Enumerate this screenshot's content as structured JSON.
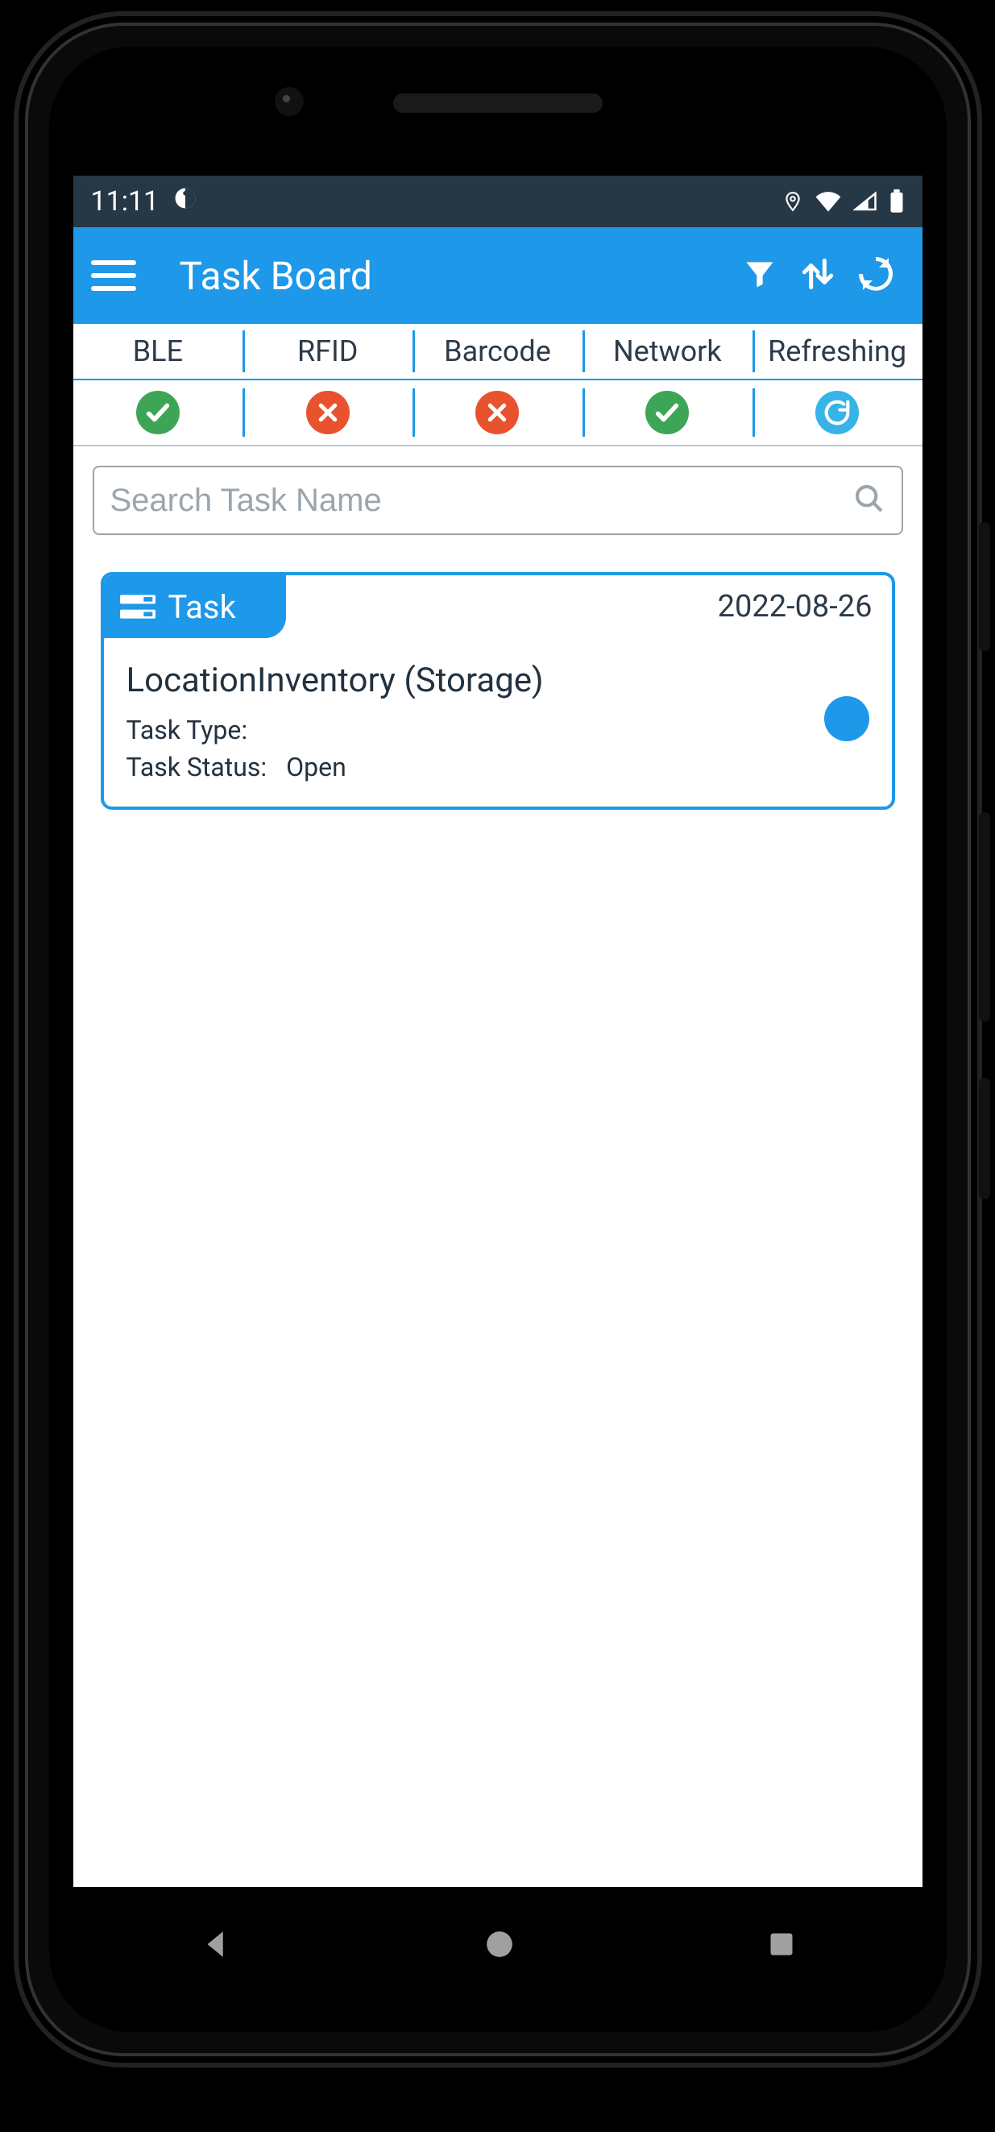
{
  "status_bar": {
    "time": "11:11",
    "icons": {
      "app_indicator": "app-indicator-icon",
      "location": "location-icon",
      "wifi": "wifi-icon",
      "signal": "signal-icon",
      "battery": "battery-icon"
    }
  },
  "app_bar": {
    "title": "Task Board",
    "actions": {
      "filter": "filter-icon",
      "sort": "sort-icon",
      "refresh": "refresh-icon"
    }
  },
  "status_strip": {
    "columns": [
      "BLE",
      "RFID",
      "Barcode",
      "Network",
      "Refreshing"
    ],
    "states": [
      "ok",
      "err",
      "err",
      "ok",
      "refresh"
    ]
  },
  "search": {
    "value": "",
    "placeholder": "Search Task Name"
  },
  "cards": [
    {
      "tab_label": "Task",
      "date": "2022-08-26",
      "title": "LocationInventory (Storage)",
      "task_type_label": "Task Type:",
      "task_type_value": "",
      "task_status_label": "Task Status:",
      "task_status_value": "Open",
      "status_color": "#1e98e8"
    }
  ],
  "nav_bar": {
    "back": "back-icon",
    "home": "home-icon",
    "recent": "recent-icon"
  }
}
